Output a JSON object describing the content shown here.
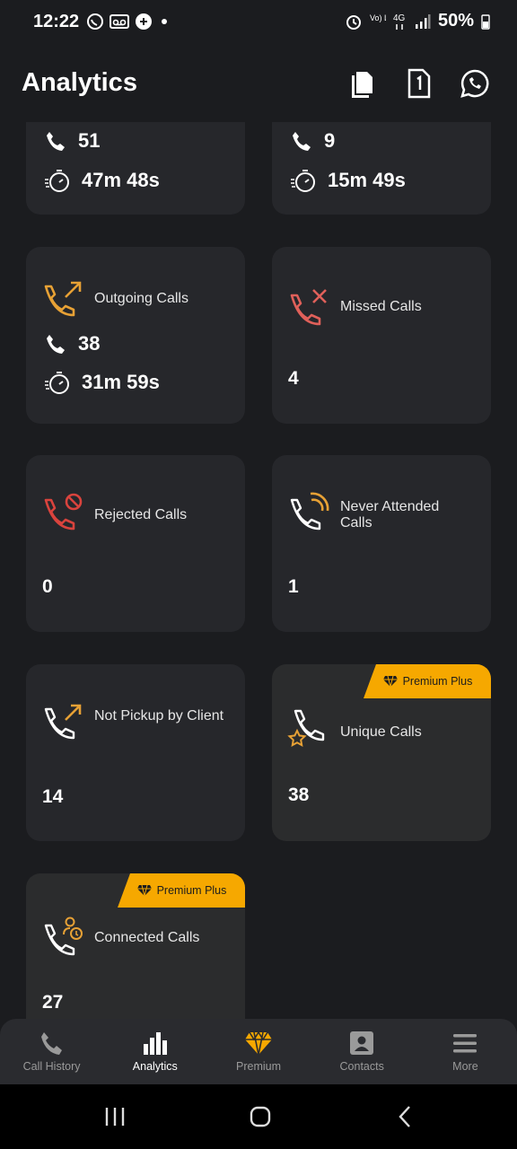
{
  "status_bar": {
    "time": "12:22",
    "battery": "50%",
    "signal_labels": [
      "Vo) LTE",
      "4G"
    ]
  },
  "header": {
    "title": "Analytics"
  },
  "cards": {
    "all_calls_left": {
      "count": "51",
      "duration": "47m 48s"
    },
    "all_calls_right": {
      "count": "9",
      "duration": "15m 49s"
    },
    "outgoing": {
      "title": "Outgoing Calls",
      "count": "38",
      "duration": "31m 59s"
    },
    "missed": {
      "title": "Missed Calls",
      "value": "4"
    },
    "rejected": {
      "title": "Rejected Calls",
      "value": "0"
    },
    "never_attended": {
      "title": "Never Attended Calls",
      "value": "1"
    },
    "not_pickup": {
      "title": "Not Pickup by Client",
      "value": "14"
    },
    "unique": {
      "title": "Unique Calls",
      "value": "38",
      "badge": "Premium Plus"
    },
    "connected": {
      "title": "Connected Calls",
      "value": "27",
      "badge": "Premium Plus"
    }
  },
  "bottom_nav": {
    "items": [
      {
        "label": "Call History",
        "icon": "phone-icon"
      },
      {
        "label": "Analytics",
        "icon": "bar-chart-icon",
        "active": true
      },
      {
        "label": "Premium",
        "icon": "diamond-icon"
      },
      {
        "label": "Contacts",
        "icon": "contact-card-icon"
      },
      {
        "label": "More",
        "icon": "hamburger-icon"
      }
    ]
  },
  "colors": {
    "background": "#1b1c1f",
    "card": "#26272b",
    "premium": "#f6a800",
    "accent_orange": "#e7a135",
    "accent_red": "#d9534f"
  }
}
